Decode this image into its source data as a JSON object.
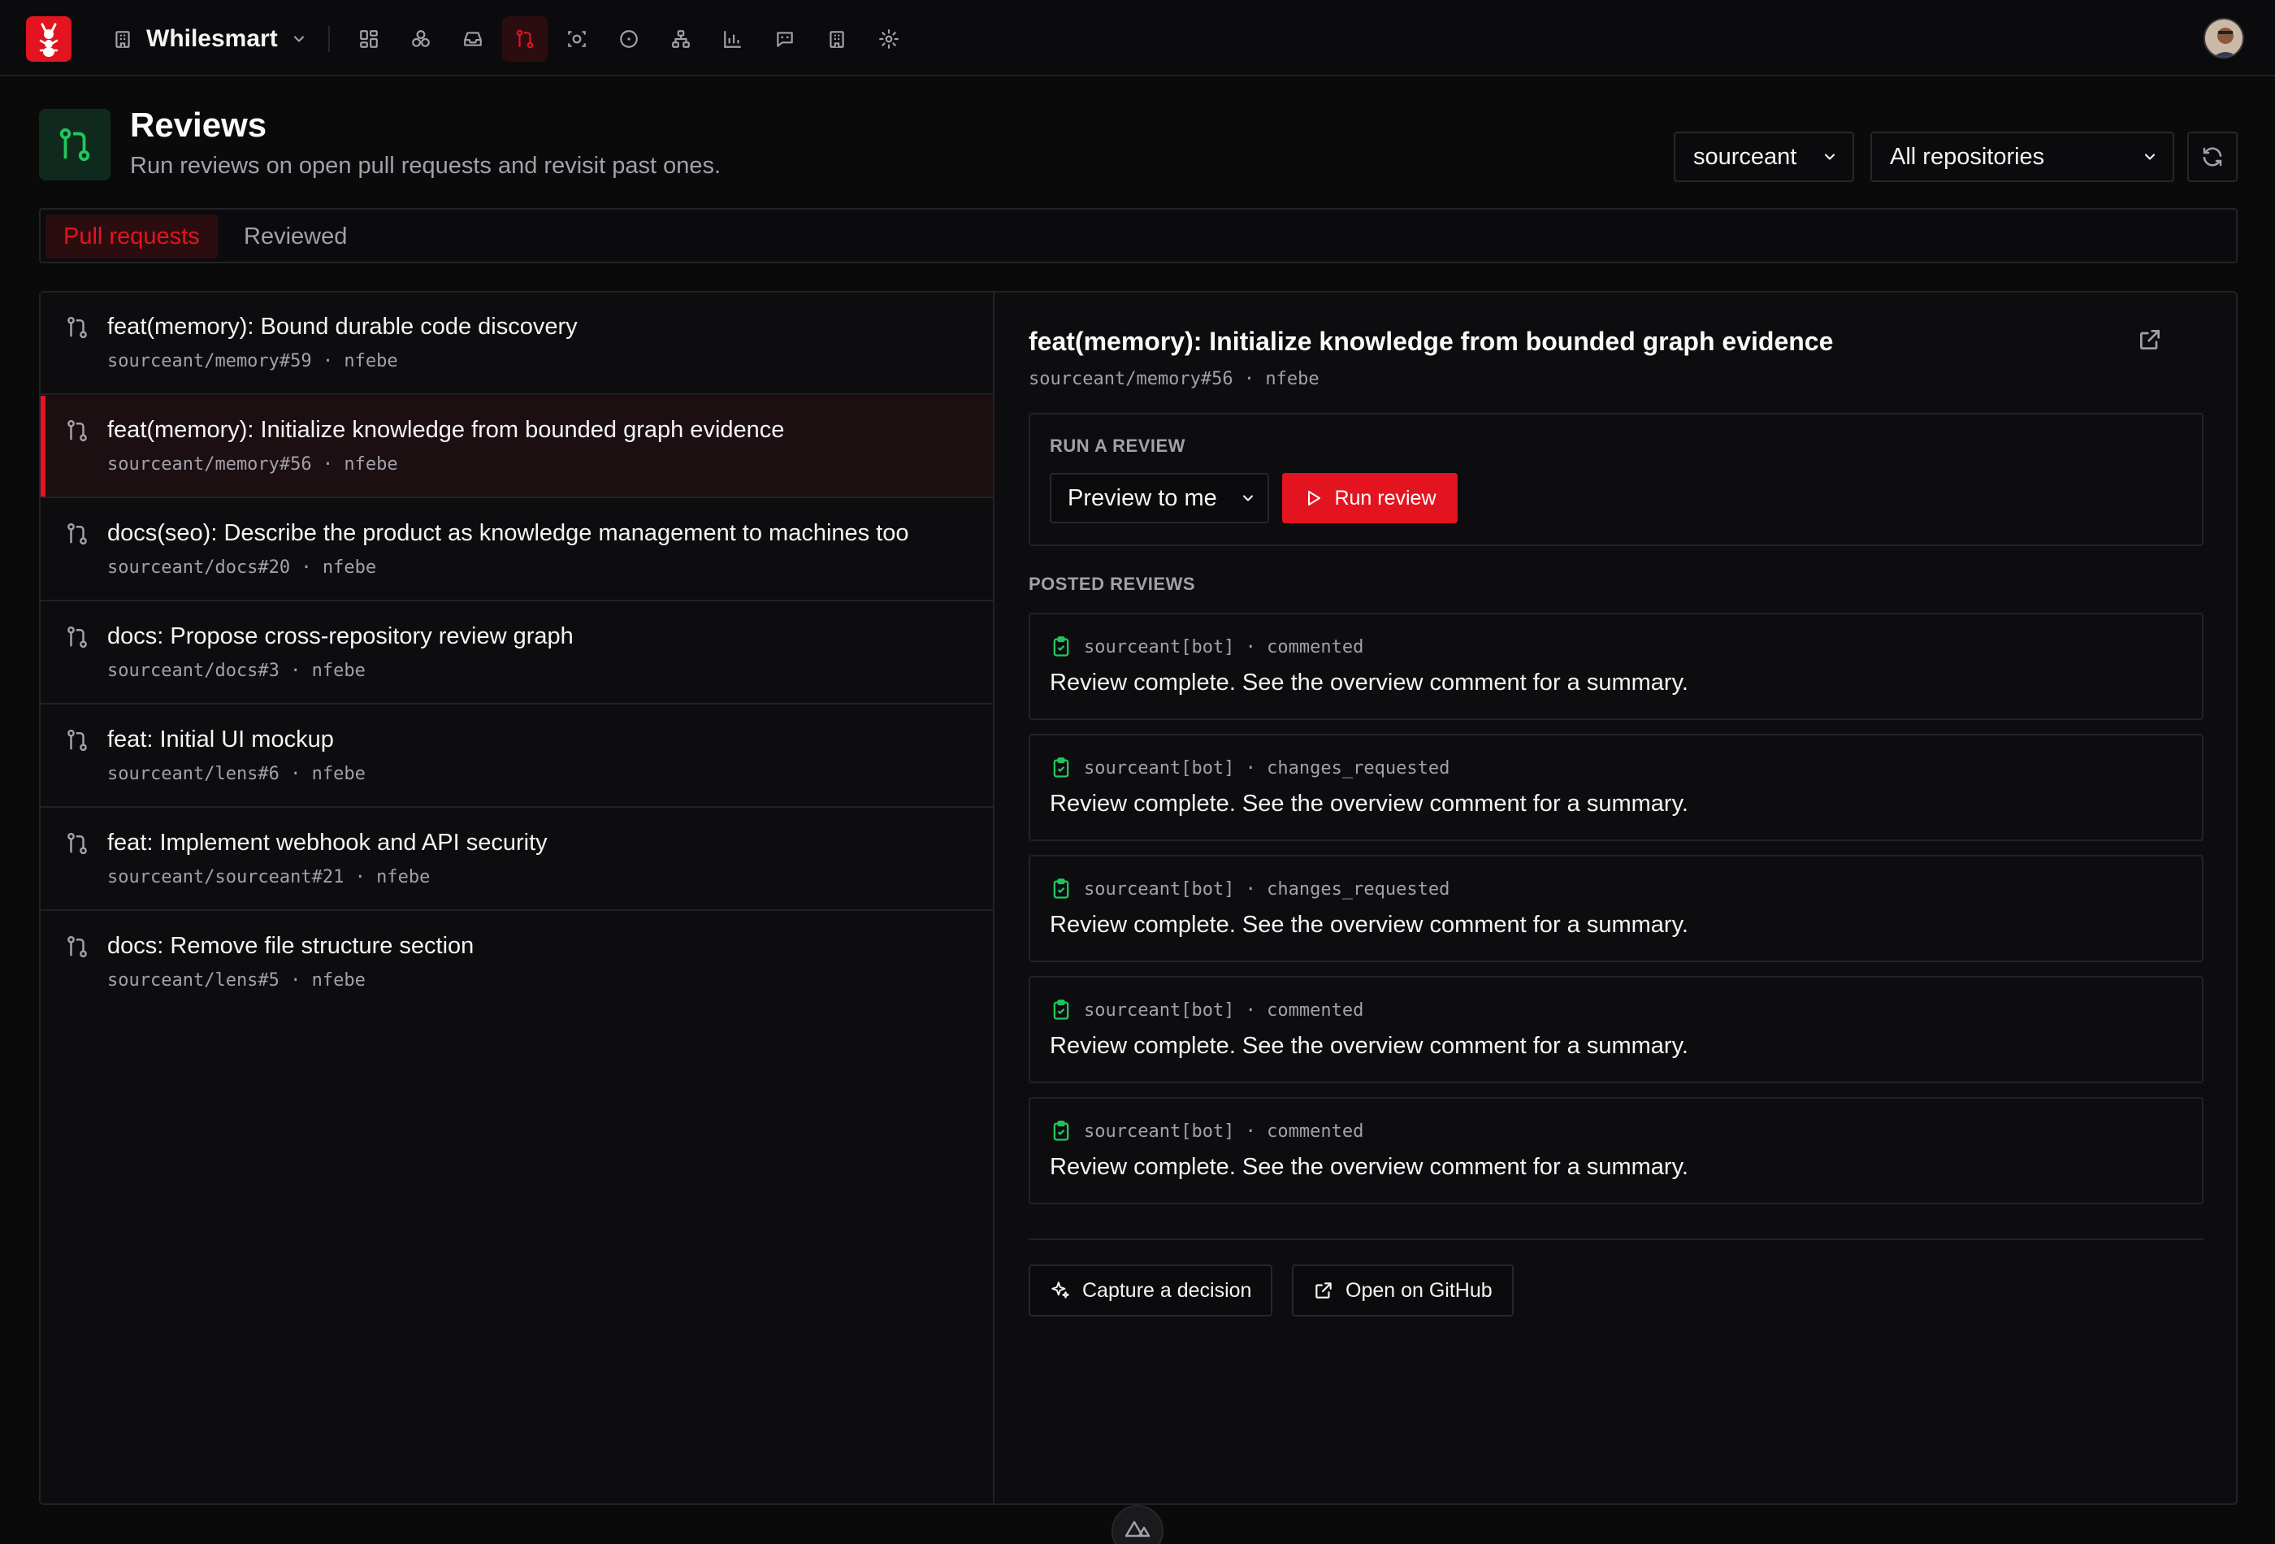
{
  "topbar": {
    "org_name": "Whilesmart",
    "nav_icons": [
      "dashboard-icon",
      "integrations-icon",
      "inbox-icon",
      "pull-request-icon",
      "scan-icon",
      "circle-icon",
      "graph-icon",
      "chart-icon",
      "chat-icon",
      "building-icon",
      "settings-icon"
    ],
    "active_nav": "pull-request-icon"
  },
  "header": {
    "title": "Reviews",
    "subtitle": "Run reviews on open pull requests and revisit past ones.",
    "owner_select": "sourceant",
    "repo_select": "All repositories"
  },
  "tabs": [
    {
      "label": "Pull requests",
      "active": true
    },
    {
      "label": "Reviewed",
      "active": false
    }
  ],
  "pull_requests": [
    {
      "title": "feat(memory): Bound durable code discovery",
      "meta": "sourceant/memory#59 · nfebe",
      "selected": false
    },
    {
      "title": "feat(memory): Initialize knowledge from bounded graph evidence",
      "meta": "sourceant/memory#56 · nfebe",
      "selected": true
    },
    {
      "title": "docs(seo): Describe the product as knowledge management to machines too",
      "meta": "sourceant/docs#20 · nfebe",
      "selected": false
    },
    {
      "title": "docs: Propose cross-repository review graph",
      "meta": "sourceant/docs#3 · nfebe",
      "selected": false
    },
    {
      "title": "feat: Initial UI mockup",
      "meta": "sourceant/lens#6 · nfebe",
      "selected": false
    },
    {
      "title": "feat: Implement webhook and API security",
      "meta": "sourceant/sourceant#21 · nfebe",
      "selected": false
    },
    {
      "title": "docs: Remove file structure section",
      "meta": "sourceant/lens#5 · nfebe",
      "selected": false
    }
  ],
  "detail": {
    "title": "feat(memory): Initialize knowledge from bounded graph evidence",
    "meta": "sourceant/memory#56 · nfebe",
    "run_label": "RUN A REVIEW",
    "mode_select": "Preview to me",
    "run_button": "Run review",
    "posted_label": "POSTED REVIEWS",
    "reviews": [
      {
        "meta": "sourceant[bot] · commented",
        "body": "Review complete. See the overview comment for a summary."
      },
      {
        "meta": "sourceant[bot] · changes_requested",
        "body": "Review complete. See the overview comment for a summary."
      },
      {
        "meta": "sourceant[bot] · changes_requested",
        "body": "Review complete. See the overview comment for a summary."
      },
      {
        "meta": "sourceant[bot] · commented",
        "body": "Review complete. See the overview comment for a summary."
      },
      {
        "meta": "sourceant[bot] · commented",
        "body": "Review complete. See the overview comment for a summary."
      }
    ],
    "capture_button": "Capture a decision",
    "github_button": "Open on GitHub"
  },
  "colors": {
    "accent": "#e3141f",
    "success": "#22c55e",
    "background": "#0a0a0b"
  }
}
